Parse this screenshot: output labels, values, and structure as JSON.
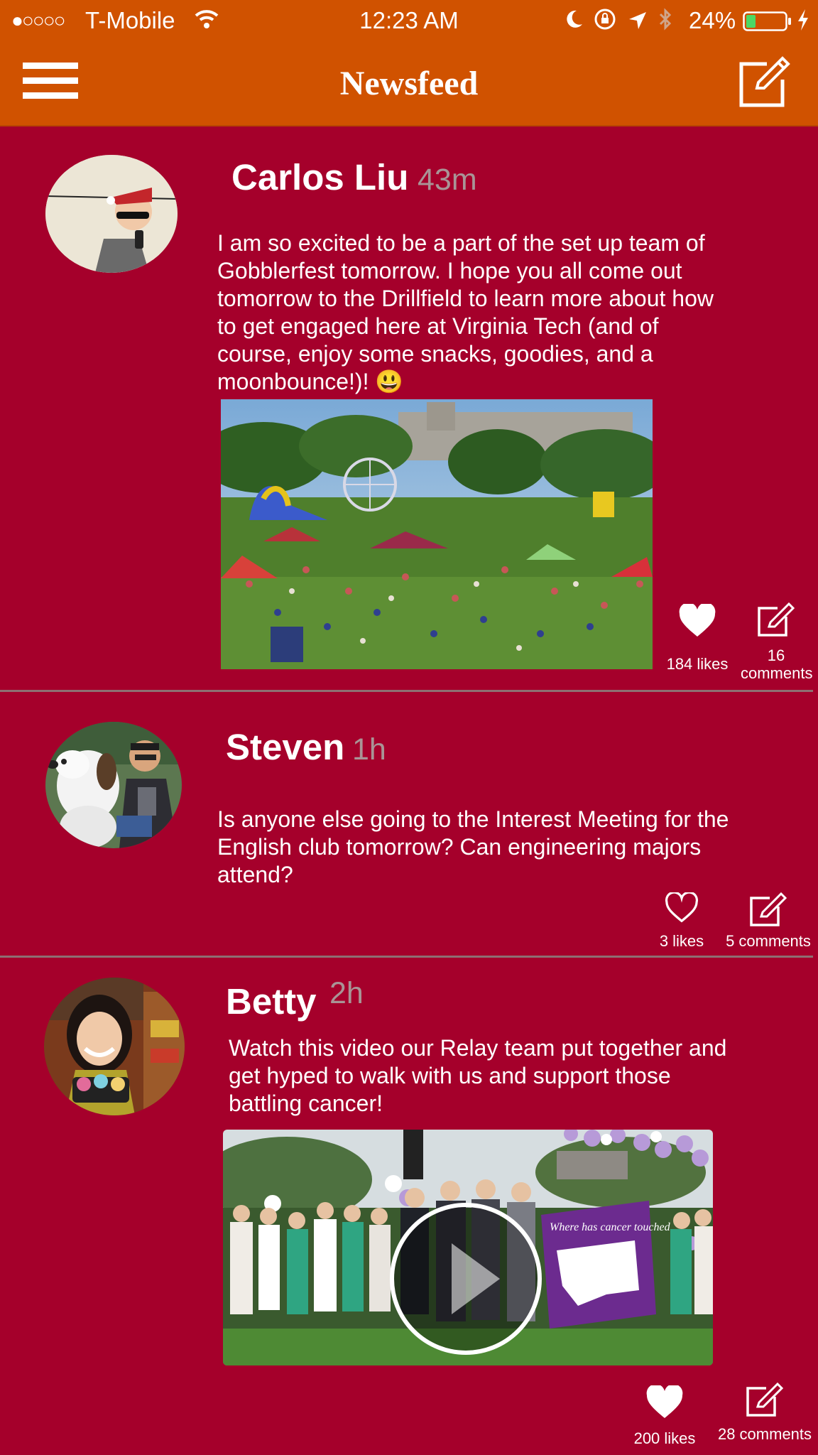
{
  "status_bar": {
    "signal_dots": "●○○○○",
    "carrier": "T-Mobile",
    "wifi_icon": "wifi-icon",
    "time": "12:23 AM",
    "battery": "24%",
    "battery_color": "#4cd964"
  },
  "nav": {
    "title": "Newsfeed",
    "menu_icon": "hamburger-menu-icon",
    "compose_icon": "compose-icon"
  },
  "colors": {
    "nav_bar": "#d05200",
    "feed_background": "#a5002b",
    "timestamp": "#a99496",
    "divider": "#8e6f72"
  },
  "posts": [
    {
      "author": "Carlos Liu",
      "time": "43m",
      "body": "I am so excited to be a part of the set up team of Gobblerfest tomorrow. I hope you all come out tomorrow to the Drillfield to learn more about how to get engaged here at Virginia Tech (and of course, enjoy some snacks, goodies, and a moonbounce!)! 😃",
      "media": "photo of an outdoor festival on a lawn with tents, a ferris wheel and inflatable slides",
      "liked": true,
      "likes": "184 likes",
      "comments": "16 comments"
    },
    {
      "author": "Steven",
      "time": "1h",
      "body": "Is anyone else going to the Interest Meeting for the English club tomorrow? Can engineering majors attend?",
      "liked": false,
      "likes": "3 likes",
      "comments": "5 comments"
    },
    {
      "author": "Betty",
      "time": "2h",
      "body": "Watch this video our Relay team put together and get hyped to walk with us and support those battling cancer!",
      "media": "video thumbnail of a Relay for Life crowd with purple balloons",
      "banner_text": "Where has cancer touched",
      "liked": true,
      "likes": "200 likes",
      "comments": "28 comments"
    }
  ]
}
